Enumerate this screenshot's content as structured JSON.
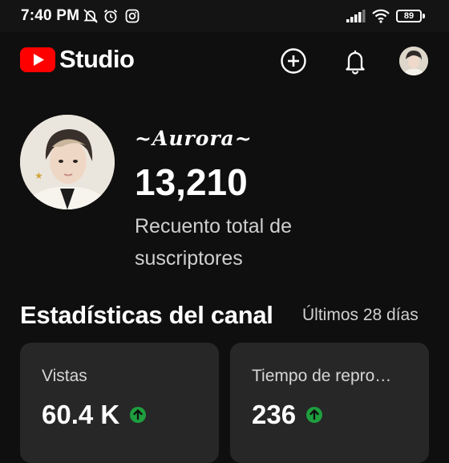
{
  "status_bar": {
    "time": "7:40 PM",
    "battery": "89",
    "icons": [
      "mute-bell-icon",
      "alarm-icon",
      "instagram-icon",
      "signal-icon",
      "wifi-icon",
      "battery-icon"
    ]
  },
  "app_bar": {
    "logo_text": "Studio",
    "brand_color": "#ff0000",
    "actions": [
      "add-icon",
      "bell-icon",
      "account-avatar"
    ]
  },
  "channel": {
    "name": "~Aurora~",
    "subscriber_count": "13,210",
    "subscriber_label": "Recuento total de suscriptores"
  },
  "stats": {
    "title": "Estadísticas del canal",
    "range": "Últimos 28 días",
    "cards": [
      {
        "label": "Vistas",
        "value": "60.4 K",
        "trend": "up",
        "trend_color": "#1e9e3e"
      },
      {
        "label": "Tiempo de repro…",
        "value": "236",
        "trend": "up",
        "trend_color": "#1e9e3e"
      }
    ]
  }
}
